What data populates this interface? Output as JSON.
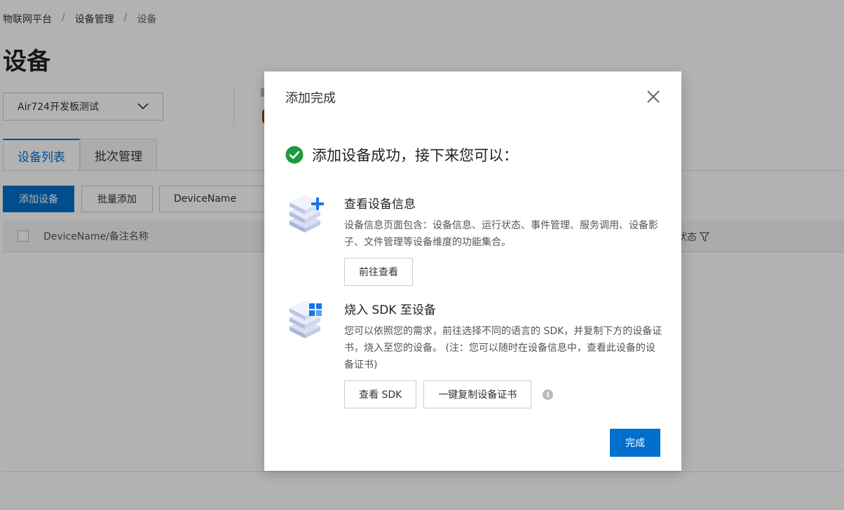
{
  "breadcrumb": [
    "物联网平台",
    "设备管理",
    "设备"
  ],
  "page": {
    "title": "设备",
    "product_select": "Air724开发板测试",
    "tabs": [
      "设备列表",
      "批次管理"
    ],
    "buttons": {
      "add_device": "添加设备",
      "batch_add": "批量添加"
    },
    "search_field": "DeviceName",
    "table": {
      "col_name": "DeviceName/备注名称",
      "col_status": "状态"
    }
  },
  "modal": {
    "title": "添加完成",
    "success_text": "添加设备成功，接下来您可以：",
    "section1": {
      "title": "查看设备信息",
      "desc": "设备信息页面包含：设备信息、运行状态、事件管理、服务调用、设备影子、文件管理等设备维度的功能集合。",
      "button": "前往查看"
    },
    "section2": {
      "title": "烧入 SDK 至设备",
      "desc": "您可以依照您的需求，前往选择不同的语言的 SDK，并复制下方的设备证书，烧入至您的设备。 (注：您可以随时在设备信息中，查看此设备的设备证书)",
      "button_sdk": "查看 SDK",
      "button_copy": "一键复制设备证书"
    },
    "done": "完成"
  },
  "colors": {
    "accent": "#0070cc",
    "success": "#1e9a3e"
  }
}
